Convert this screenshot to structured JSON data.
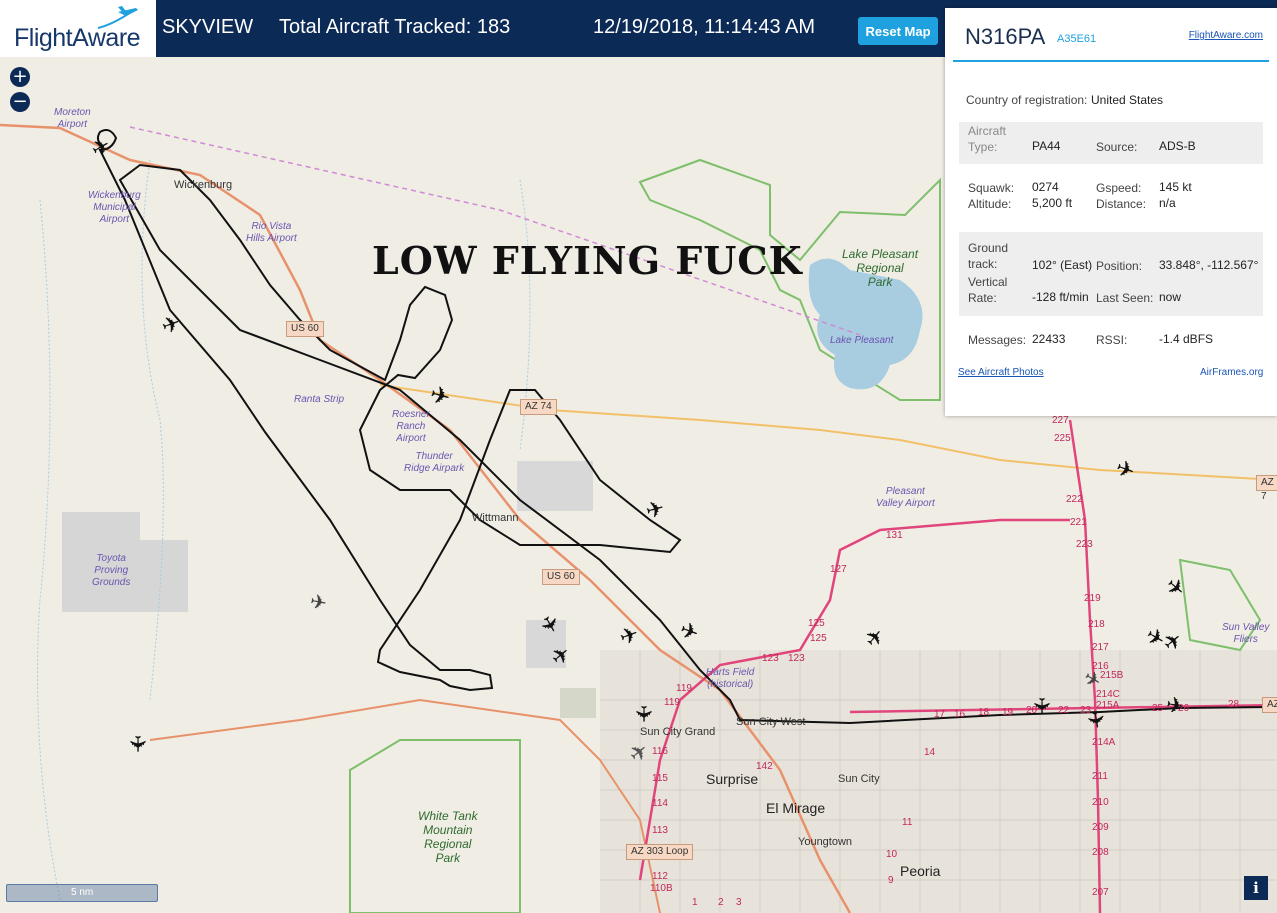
{
  "header": {
    "logo_text": "FlightAware",
    "app_name": "SKYVIEW",
    "aircraft_tracked": "Total Aircraft Tracked: 183",
    "datetime": "12/19/2018, 11:14:43 AM",
    "reset_label": "Reset Map"
  },
  "map": {
    "zoom_in": "+",
    "zoom_out": "−",
    "caption": "LOW FLYING FUCK",
    "scale_label": "5 nm",
    "info": "i",
    "labels": {
      "moreton": "Moreton\nAirport",
      "wickenburg": "Wickenburg",
      "wickenburg_airport": "Wickenburg\nMunicipal\nAirport",
      "rio_vista": "Rio Vista\nHills Airport",
      "ranta": "Ranta Strip",
      "roesner": "Roesner\nRanch\nAirport",
      "thunder": "Thunder\nRidge Airpark",
      "wittmann": "Wittmann",
      "toyota": "Toyota\nProving\nGrounds",
      "lake_pleasant_park": "Lake Pleasant\nRegional\nPark",
      "lake_pleasant": "Lake Pleasant",
      "pleasant_valley": "Pleasant\nValley Airport",
      "harts": "Harts Field\n(historical)",
      "sun_city_grand": "Sun City Grand",
      "sun_city_west": "Sun City West",
      "surprise": "Surprise",
      "el_mirage": "El Mirage",
      "sun_city": "Sun City",
      "youngtown": "Youngtown",
      "peoria": "Peoria",
      "white_tank": "White Tank\nMountain\nRegional\nPark",
      "sun_valley": "Sun Valley\nFliers"
    },
    "shields": {
      "us60a": "US 60",
      "az74": "AZ 74",
      "us60b": "US 60",
      "az303": "AZ 303 Loop",
      "az_right": "AZ 7",
      "az_right2": "AZ"
    },
    "route_numbers": [
      "227",
      "225",
      "222",
      "221",
      "223",
      "219",
      "218",
      "217",
      "216",
      "215B",
      "214C",
      "215A",
      "214A",
      "211",
      "210",
      "209",
      "208",
      "207",
      "131",
      "127",
      "125",
      "125",
      "123",
      "123",
      "119",
      "119",
      "116",
      "115",
      "114",
      "113",
      "112",
      "110B",
      "142",
      "17",
      "16",
      "18",
      "19",
      "20",
      "22",
      "23",
      "26",
      "25",
      "28",
      "14",
      "11",
      "10",
      "9",
      "2",
      "3",
      "1"
    ]
  },
  "panel": {
    "registration": "N316PA",
    "hex": "A35E61",
    "flightaware_link": "FlightAware.com",
    "country_label": "Country of registration:",
    "country": "United States",
    "aircraft_type_label": "Aircraft\nType:",
    "aircraft_type": "PA44",
    "source_label": "Source:",
    "source": "ADS-B",
    "squawk_label": "Squawk:",
    "squawk": "0274",
    "altitude_label": "Altitude:",
    "altitude": "5,200 ft",
    "gspeed_label": "Gspeed:",
    "gspeed": "145 kt",
    "distance_label": "Distance:",
    "distance": "n/a",
    "ground_track_label": "Ground\ntrack:",
    "ground_track": "102° (East)",
    "position_label": "Position:",
    "position": "33.848°, -112.567°",
    "vertical_rate_label": "Vertical\nRate:",
    "vertical_rate": "-128 ft/min",
    "last_seen_label": "Last Seen:",
    "last_seen": "now",
    "messages_label": "Messages:",
    "messages": "22433",
    "rssi_label": "RSSI:",
    "rssi": "-1.4 dBFS",
    "photos_link": "See Aircraft Photos",
    "airframes_link": "AirFrames.org"
  },
  "colors": {
    "header_bg": "#0c2a56",
    "accent": "#1ea1de",
    "map_bg": "#f0ede5",
    "highway": "#e8926c",
    "freeway": "#e0457b",
    "track": "#111111"
  }
}
